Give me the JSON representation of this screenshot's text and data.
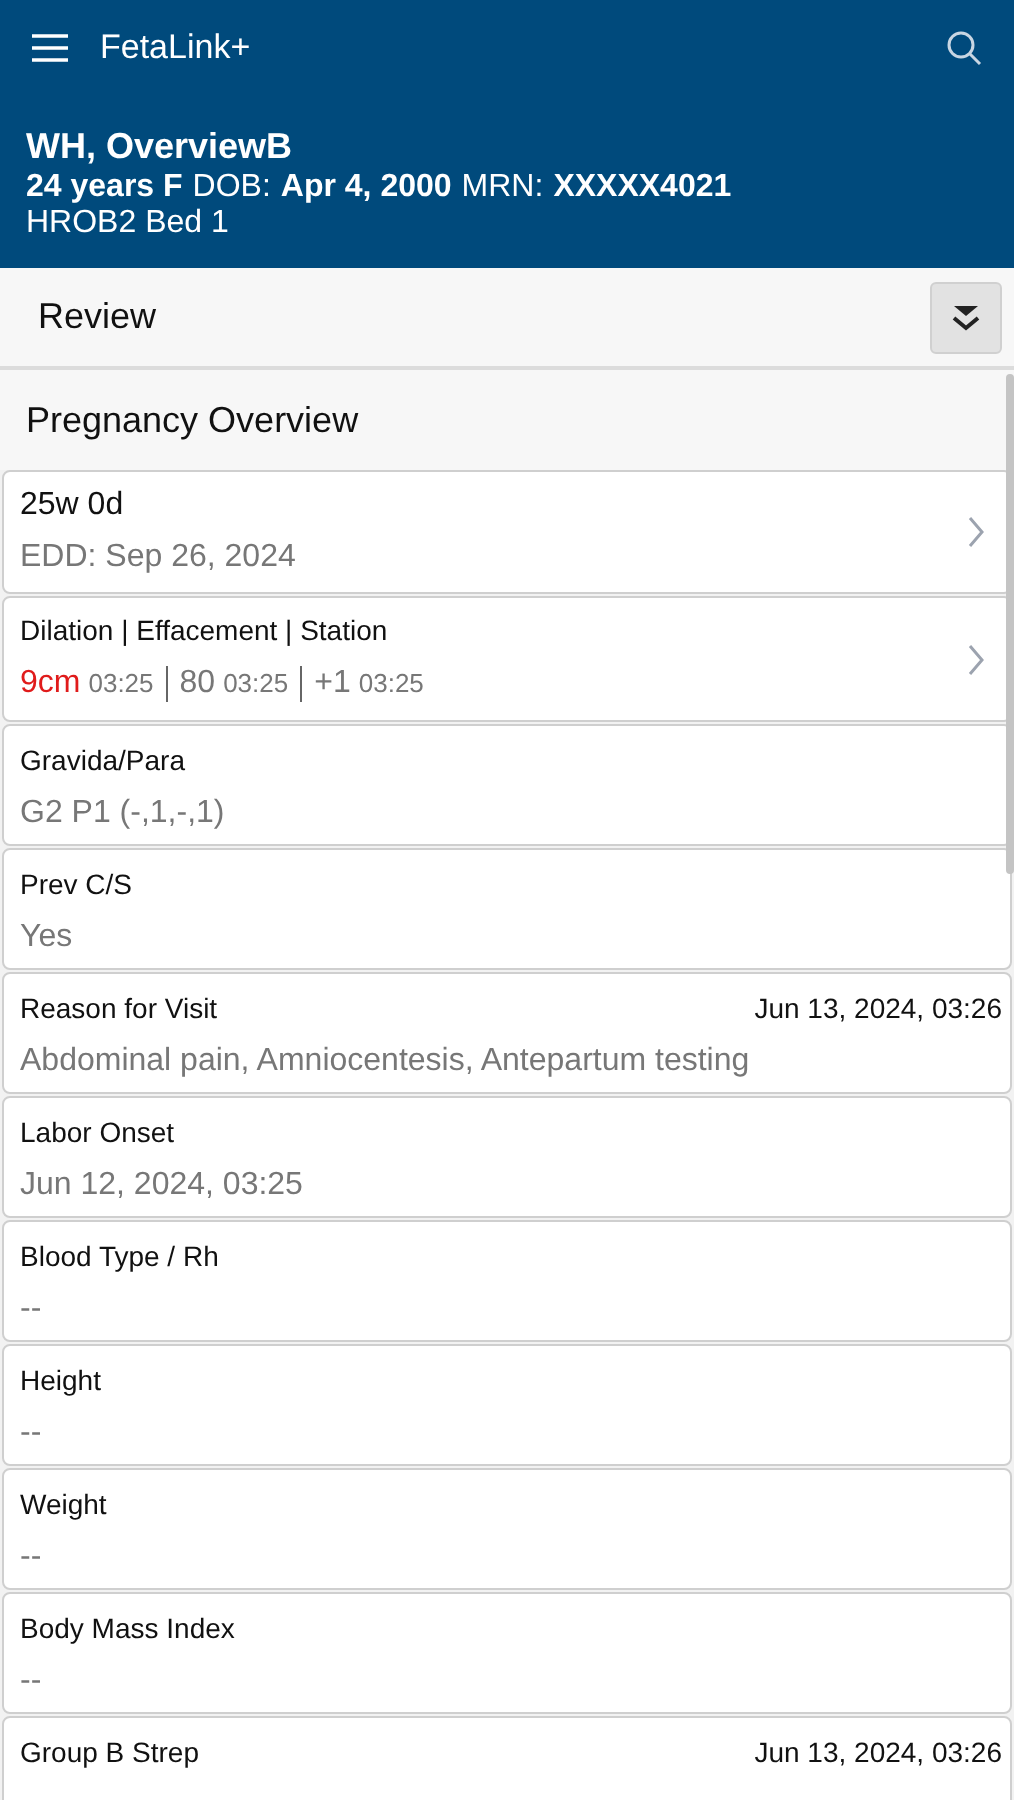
{
  "app_bar": {
    "title": "FetaLink+"
  },
  "patient": {
    "name": "WH, OverviewB",
    "age_sex": "24 years F",
    "dob_label": "DOB:",
    "dob": "Apr 4, 2000",
    "mrn_label": "MRN:",
    "mrn": "XXXXX4021",
    "location": "HROB2 Bed 1"
  },
  "review_bar": {
    "title": "Review",
    "expanded": false
  },
  "section": {
    "title": "Pregnancy Overview"
  },
  "cards": [
    {
      "kind": "summary",
      "label": "25w 0d",
      "value": "EDD: Sep 26, 2024",
      "navigable": true
    },
    {
      "kind": "exam",
      "label": "Dilation | Effacement | Station",
      "navigable": true,
      "readings": [
        {
          "value": "9cm",
          "time": "03:25",
          "alert": true
        },
        {
          "value": "80",
          "time": "03:25",
          "alert": false
        },
        {
          "value": "+1",
          "time": "03:25",
          "alert": false
        }
      ]
    },
    {
      "kind": "field",
      "label": "Gravida/Para",
      "value": "G2 P1 (-,1,-,1)",
      "navigable": false
    },
    {
      "kind": "field",
      "label": "Prev C/S",
      "value": "Yes",
      "navigable": false
    },
    {
      "kind": "field",
      "label": "Reason for Visit",
      "timestamp": "Jun 13, 2024, 03:26",
      "value": "Abdominal pain, Amniocentesis, Antepartum testing",
      "navigable": false
    },
    {
      "kind": "field",
      "label": "Labor Onset",
      "value": "Jun 12, 2024, 03:25",
      "navigable": false
    },
    {
      "kind": "field",
      "label": "Blood Type / Rh",
      "value": "--",
      "navigable": false
    },
    {
      "kind": "field",
      "label": "Height",
      "value": "--",
      "navigable": false
    },
    {
      "kind": "field",
      "label": "Weight",
      "value": "--",
      "navigable": false
    },
    {
      "kind": "field",
      "label": "Body Mass Index",
      "value": "--",
      "navigable": false
    },
    {
      "kind": "field",
      "label": "Group B Strep",
      "timestamp": "Jun 13, 2024, 03:26",
      "navigable": false
    }
  ]
}
